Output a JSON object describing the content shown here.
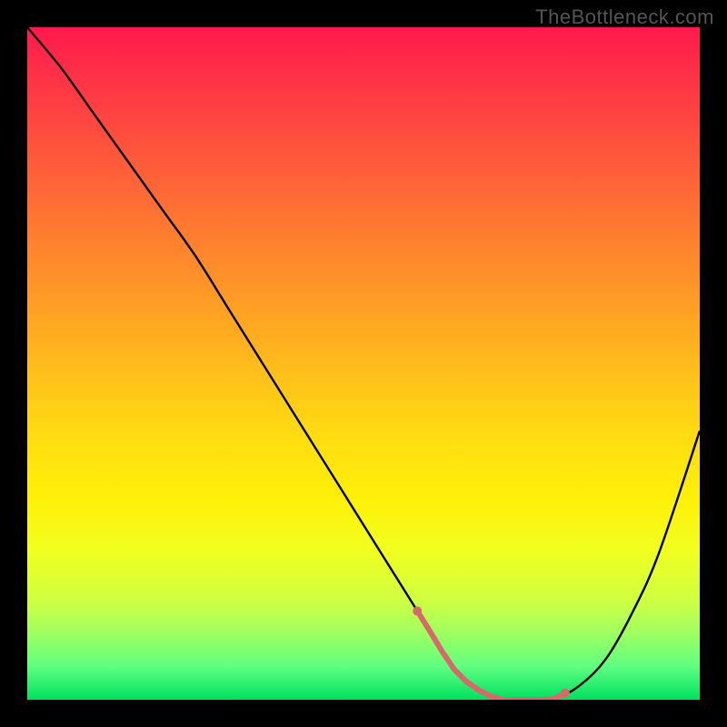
{
  "watermark": "TheBottleneck.com",
  "colors": {
    "background": "#000000",
    "curve": "#000000",
    "marker": "#d66a6a",
    "gradient_top": "#ff1a4d",
    "gradient_bottom": "#00e060"
  },
  "chart_data": {
    "type": "line",
    "title": "",
    "xlabel": "",
    "ylabel": "",
    "xlim": [
      0,
      100
    ],
    "ylim": [
      0,
      100
    ],
    "x": [
      0,
      5,
      10,
      15,
      20,
      25,
      30,
      35,
      40,
      45,
      50,
      55,
      60,
      63,
      66,
      70,
      74,
      78,
      82,
      86,
      90,
      94,
      100
    ],
    "values": [
      100,
      94,
      87,
      80,
      73,
      66,
      58,
      50,
      42,
      34,
      26,
      18,
      10,
      5,
      2,
      0,
      0,
      0,
      2,
      6,
      13,
      22,
      40
    ],
    "highlight_range_x": [
      58,
      80
    ],
    "highlight_points_x": [
      58,
      80
    ],
    "annotations": []
  }
}
